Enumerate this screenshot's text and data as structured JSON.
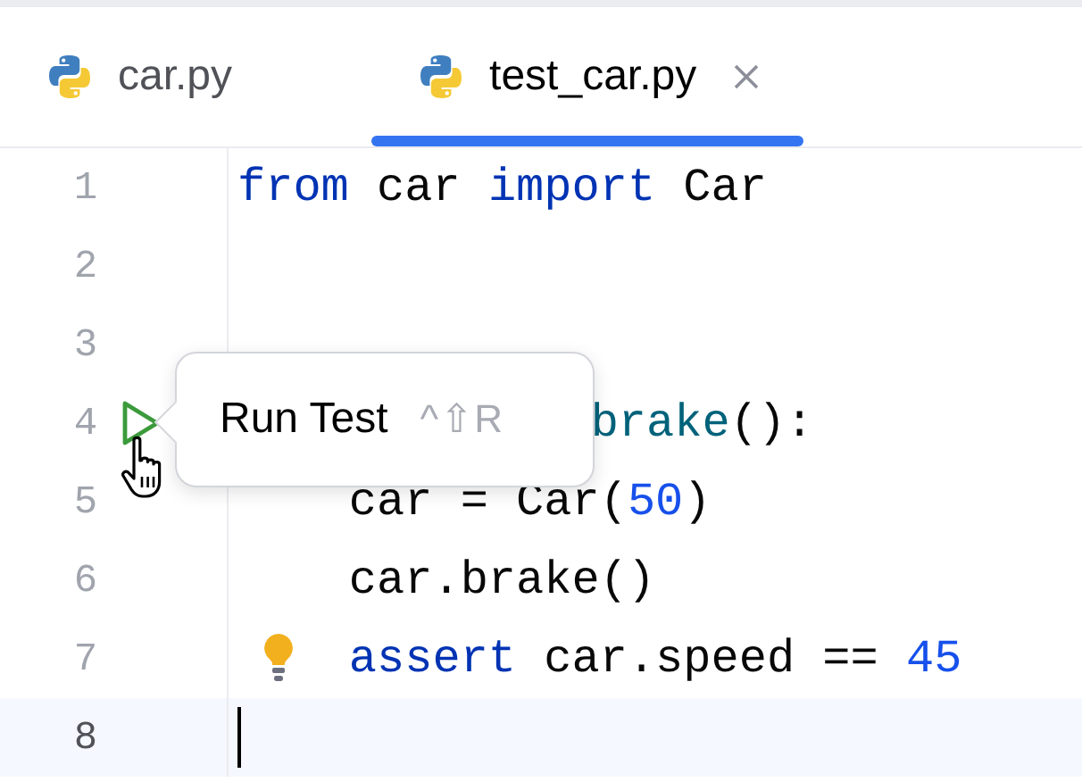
{
  "tabs": [
    {
      "label": "car.py",
      "selected": false,
      "closable": false
    },
    {
      "label": "test_car.py",
      "selected": true,
      "closable": true
    }
  ],
  "lines": [
    {
      "number": "1",
      "current": false,
      "tokens": [
        {
          "text": "from",
          "kind": "keyword"
        },
        {
          "text": " car ",
          "kind": "plain"
        },
        {
          "text": "import",
          "kind": "keyword"
        },
        {
          "text": " Car",
          "kind": "plain"
        }
      ]
    },
    {
      "number": "2",
      "current": false
    },
    {
      "number": "3",
      "current": false
    },
    {
      "number": "4",
      "current": false,
      "covered": true,
      "run_marker": true,
      "tokens": [
        {
          "text": "brake",
          "kind": "function"
        },
        {
          "text": "():",
          "kind": "plain"
        }
      ]
    },
    {
      "number": "5",
      "current": false,
      "indented": true,
      "tokens": [
        {
          "text": "car = Car(",
          "kind": "plain"
        },
        {
          "text": "50",
          "kind": "number"
        },
        {
          "text": ")",
          "kind": "plain"
        }
      ]
    },
    {
      "number": "6",
      "current": false,
      "indented": true,
      "tokens": [
        {
          "text": "car.brake()",
          "kind": "plain"
        }
      ]
    },
    {
      "number": "7",
      "current": false,
      "indented": true,
      "bulb": true,
      "tokens": [
        {
          "text": "assert",
          "kind": "keyword"
        },
        {
          "text": " car.speed == ",
          "kind": "plain"
        },
        {
          "text": "45",
          "kind": "number"
        }
      ]
    },
    {
      "number": "8",
      "current": true
    }
  ],
  "tooltip": {
    "label": "Run Test",
    "shortcut": "^⇧R"
  }
}
